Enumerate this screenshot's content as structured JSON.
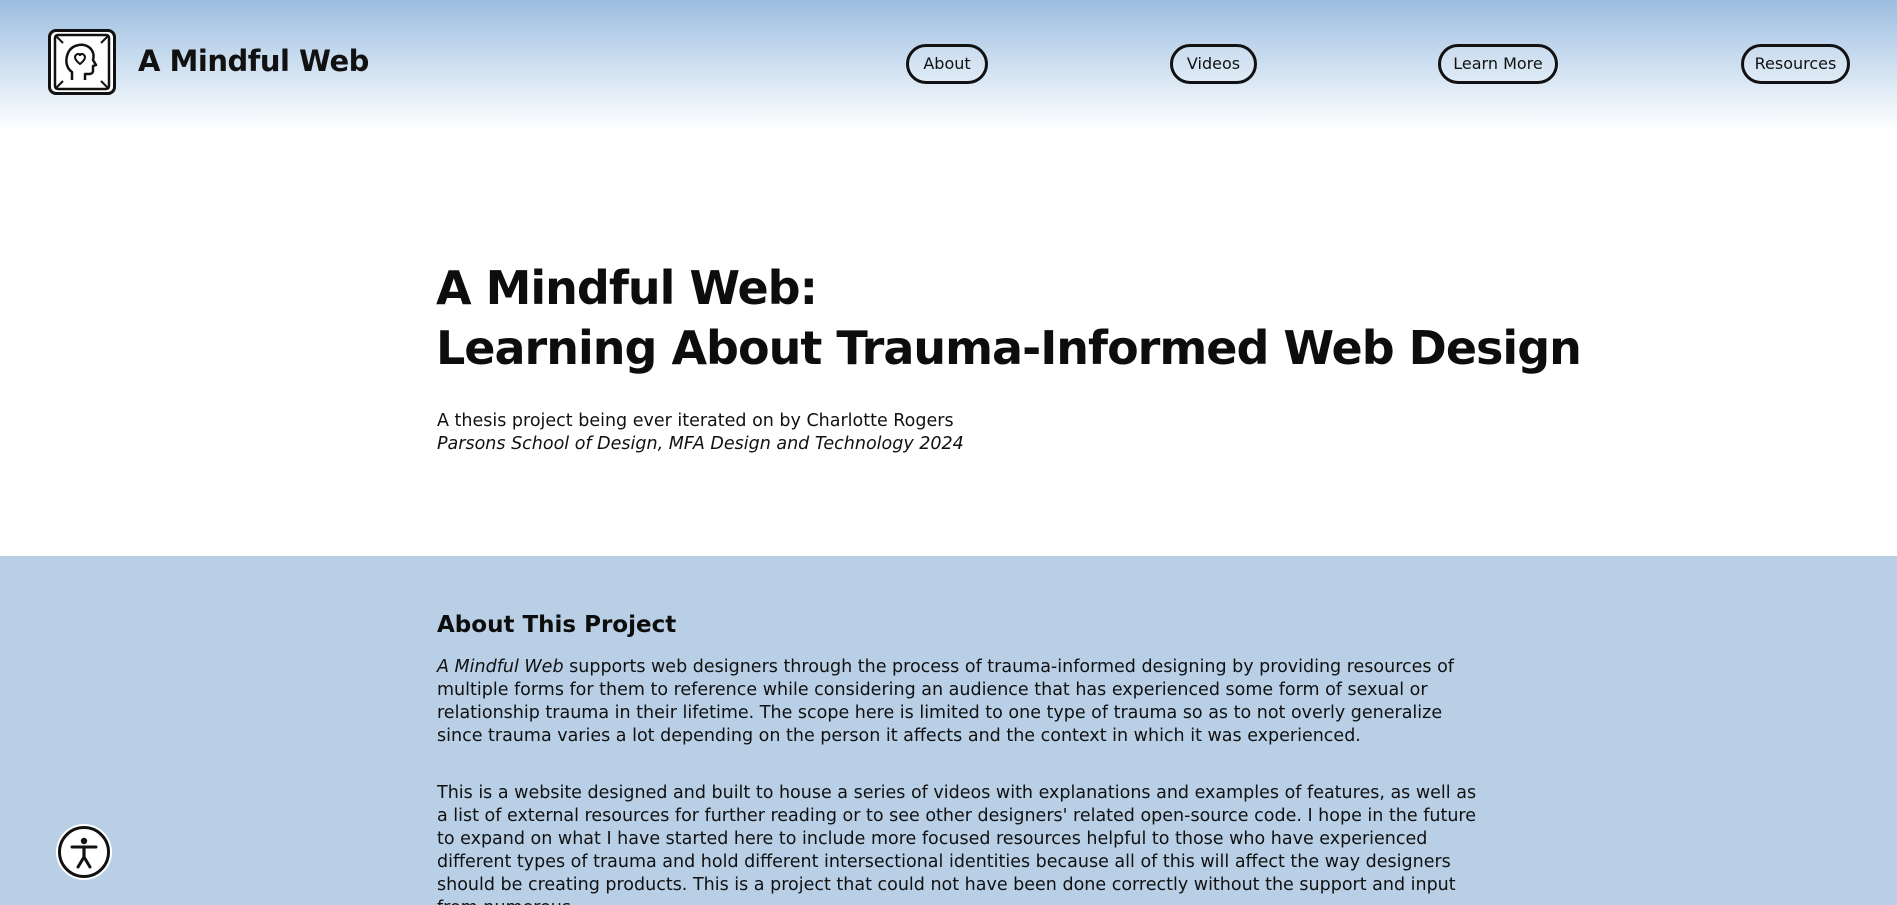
{
  "header": {
    "brand": "A Mindful Web",
    "logo_icon": "head-with-heart-icon",
    "nav": [
      {
        "label": "About"
      },
      {
        "label": "Videos"
      },
      {
        "label": "Learn More"
      },
      {
        "label": "Resources"
      }
    ]
  },
  "hero": {
    "title_line1": "A Mindful Web:",
    "title_line2": "Learning About Trauma-Informed Web Design",
    "byline": "A thesis project being ever iterated on by Charlotte Rogers",
    "school": "Parsons School of Design, MFA Design and Technology 2024"
  },
  "about": {
    "heading": "About This Project",
    "p1_em": "A Mindful Web",
    "p1_rest": " supports web designers through the process of trauma-informed designing by providing resources of multiple forms for them to reference while considering an audience that has experienced some form of sexual or relationship trauma in their lifetime. The scope here is limited to one type of trauma so as to not overly generalize since trauma varies a lot depending on the person it affects and the context in which it was experienced.",
    "p2": "This is a website designed and built to house a series of videos with explanations and examples of features, as well as a list of external resources for further reading or to see other designers' related open-source code. I hope in the future to expand on what I have started here to include more focused resources helpful to those who have experienced different types of trauma and hold different intersectional identities because all of this will affect the way designers should be creating products. This is a project that could not have been done correctly without the support and input from numerous"
  },
  "accessibility": {
    "icon": "accessibility-person-icon"
  },
  "colors": {
    "header_gradient_top": "#9cbde0",
    "section_background": "#b8cfe6",
    "text": "#111111"
  }
}
